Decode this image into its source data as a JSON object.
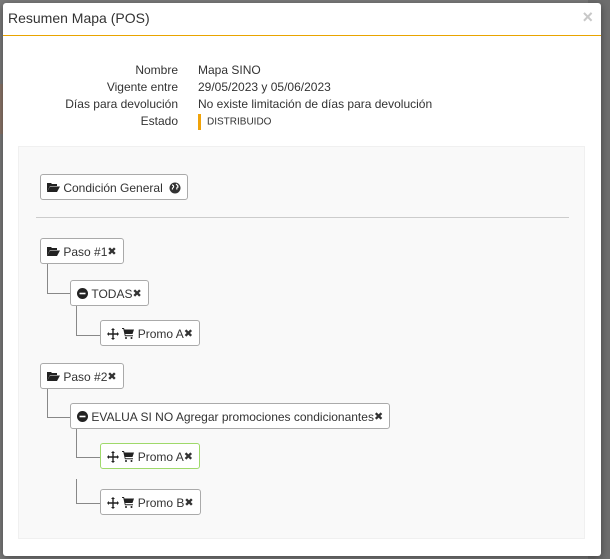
{
  "modal": {
    "title": "Resumen Mapa (POS)",
    "close_label": "×"
  },
  "info": [
    {
      "label": "Nombre",
      "value": "Mapa SINO"
    },
    {
      "label": "Vigente entre",
      "value": "29/05/2023 y 05/06/2023"
    },
    {
      "label": "Días para devolución",
      "value": "No existe limitación de días para devolución"
    },
    {
      "label": "Estado",
      "value": "DISTRIBUIDO"
    }
  ],
  "colors": {
    "accent": "#e9a400",
    "estado": "#f0a30a",
    "highlight": "#9fd96a"
  },
  "tree": {
    "general": {
      "label": "Condición General",
      "icon": "globe-icon"
    },
    "paso1": {
      "label": "Paso #1",
      "condition": "TODAS",
      "promos": [
        "Promo A"
      ]
    },
    "paso2": {
      "label": "Paso #2",
      "condition": "EVALUA SI NO Agregar promociones condicionantes",
      "promos": [
        "Promo A",
        "Promo B"
      ]
    }
  }
}
